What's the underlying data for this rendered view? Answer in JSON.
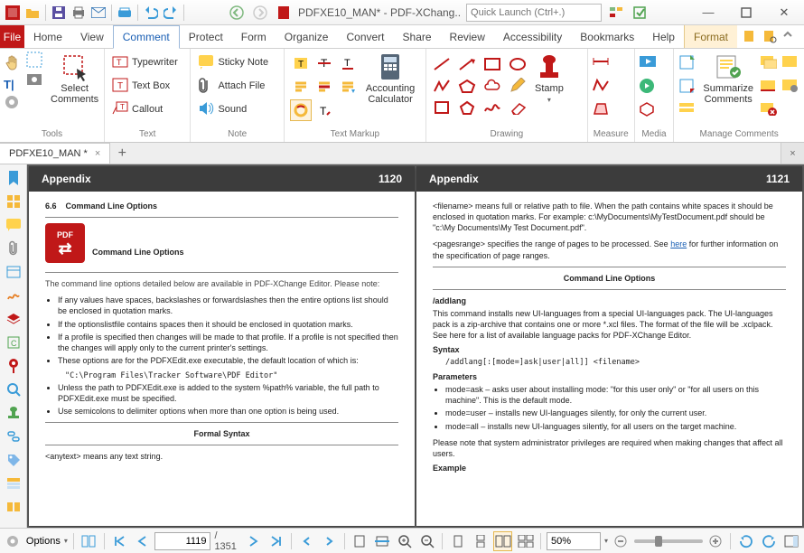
{
  "titlebar": {
    "doc_title": "PDFXE10_MAN* - PDF-XChang..",
    "search_placeholder": "Quick Launch (Ctrl+.)"
  },
  "tabs": {
    "file": "File",
    "items": [
      "Home",
      "View",
      "Comment",
      "Protect",
      "Form",
      "Organize",
      "Convert",
      "Share",
      "Review",
      "Accessibility",
      "Bookmarks",
      "Help"
    ],
    "active": "Comment",
    "format": "Format"
  },
  "ribbon": {
    "tools": {
      "label": "Tools",
      "select_comments": "Select\nComments"
    },
    "text": {
      "label": "Text",
      "typewriter": "Typewriter",
      "textbox": "Text Box",
      "callout": "Callout"
    },
    "note": {
      "label": "Note",
      "sticky": "Sticky Note",
      "attach": "Attach File",
      "sound": "Sound"
    },
    "markup": {
      "label": "Text Markup",
      "acc": "Accounting\nCalculator"
    },
    "drawing": {
      "label": "Drawing",
      "stamp": "Stamp"
    },
    "measure": {
      "label": "Measure"
    },
    "media": {
      "label": "Media"
    },
    "manage": {
      "label": "Manage Comments",
      "summarize": "Summarize\nComments"
    }
  },
  "doctab": {
    "name": "PDFXE10_MAN *"
  },
  "pages": {
    "left": {
      "header": "Appendix",
      "num": "1120",
      "section_no": "6.6",
      "section_title": "Command Line Options",
      "logo_label": "PDF",
      "logo_sub": "Command Line Options",
      "intro": "The command line options detailed below are available in PDF-XChange Editor. Please note:",
      "b1": "If any values have spaces, backslashes or forwardslashes then the entire options list should be enclosed in quotation marks.",
      "b2": "If the optionslistfile contains spaces then it should be enclosed in quotation marks.",
      "b3": "If a profile is specified then changes will be made to that profile. If a profile is not specified then the changes will apply only to the current printer's settings.",
      "b4": "These options are for the PDFXEdit.exe executable, the default location of which is:",
      "path": "\"C:\\Program Files\\Tracker Software\\PDF Editor\"",
      "b5a": "Unless the path to PDFXEdit.exe is added to the system %path% variable, the full path to PDFXEdit.exe must be specified.",
      "b6": "Use semicolons to delimiter options when more than one option is being used.",
      "formal": "Formal Syntax",
      "anytext": "<anytext> means any text string."
    },
    "right": {
      "header": "Appendix",
      "num": "1121",
      "fn1": "<filename> means full or relative path to file. When the path contains white spaces it should be enclosed in quotation marks. For example: c:\\MyDocuments\\MyTestDocument.pdf should be \"c:\\My Documents\\My Test Document.pdf\".",
      "fn2a": "<pagesrange> specifies the range of pages to be processed. See ",
      "fn2b": " for further information on the specification of page ranges.",
      "here": "here",
      "heading": "Command Line Options",
      "addlang": "/addlang",
      "addlang_desc": "This command installs new UI-languages from a special UI-languages pack. The UI-languages pack is a zip-archive that contains one or more *.xcl files. The format of the file will be .xclpack. See here for a list of available language packs for PDF-XChange Editor.",
      "syntax": "Syntax",
      "syntax_code": "/addlang[:[mode=]ask|user|all]] <filename>",
      "params": "Parameters",
      "p1": "mode=ask – asks user about installing mode: \"for this user only\" or \"for all users on this machine\". This is the default mode.",
      "p2": "mode=user – installs new UI-languages silently, for only the current user.",
      "p3": "mode=all – installs new UI-languages silently, for all users on the target machine.",
      "note": "Please note that system administrator privileges are required when making changes that affect all users.",
      "example": "Example"
    }
  },
  "status": {
    "options": "Options",
    "page_current": "1119",
    "page_total": "/ 1351",
    "zoom": "50%"
  }
}
